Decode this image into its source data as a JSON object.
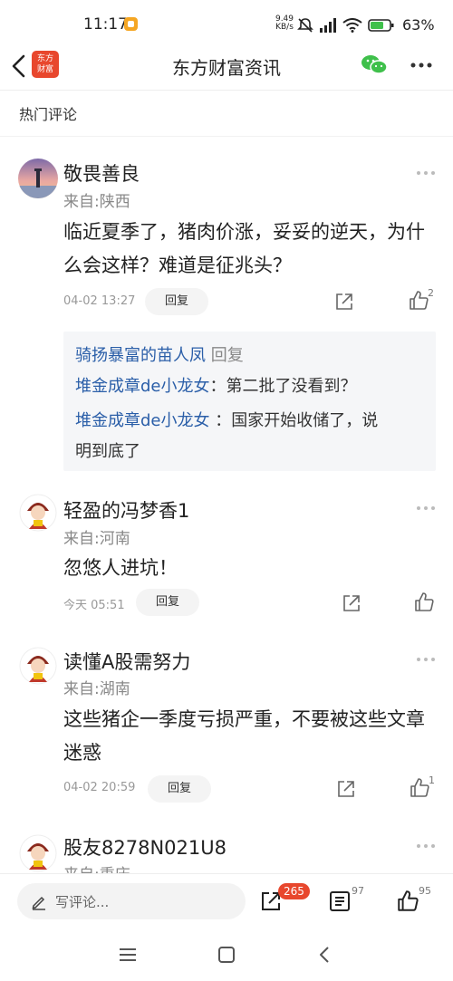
{
  "status": {
    "time": "11:17",
    "net_speed_top": "9.49",
    "net_speed_bottom": "KB/s",
    "battery": "63%"
  },
  "header": {
    "logo_line1": "东方",
    "logo_line2": "财富",
    "title": "东方财富资讯"
  },
  "section_title": "热门评论",
  "comments": [
    {
      "user": "敬畏善良",
      "location": "来自:陕西",
      "content": "临近夏季了，猪肉价涨，妥妥的逆天，为什么会这样？难道是征兆头？",
      "time": "04-02 13:27",
      "reply_label": "回复",
      "likes": "2",
      "replies": [
        {
          "name": "骑扬暴富的苗人凤",
          "text": " 回复"
        },
        {
          "name": "堆金成章de小龙女",
          "text": "：第二批了没看到？"
        },
        {
          "name": "堆金成章de小龙女",
          "text": " ：国家开始收储了，说",
          "cont": "明到底了"
        }
      ]
    },
    {
      "user": "轻盈的冯梦香1",
      "location": "来自:河南",
      "content": "忽悠人进坑！",
      "time": "今天 05:51",
      "reply_label": "回复",
      "likes": ""
    },
    {
      "user": "读懂A股需努力",
      "location": "来自:湖南",
      "content": "这些猪企一季度亏损严重，不要被这些文章迷惑",
      "time": "04-02 20:59",
      "reply_label": "回复",
      "likes": "1"
    },
    {
      "user": "股友8278N021U8",
      "location": "来自:重庆"
    }
  ],
  "bottom": {
    "placeholder": "写评论...",
    "share_count": "265",
    "list_count": "97",
    "like_count": "95"
  },
  "icons": [
    "back-icon",
    "wechat-icon",
    "more-icon",
    "share-icon",
    "like-icon",
    "pen-icon",
    "list-icon",
    "menu-icon",
    "home-icon"
  ],
  "colors": {
    "brand": "#e8472d",
    "link": "#2a5ea8",
    "wechat": "#3fc04b"
  }
}
